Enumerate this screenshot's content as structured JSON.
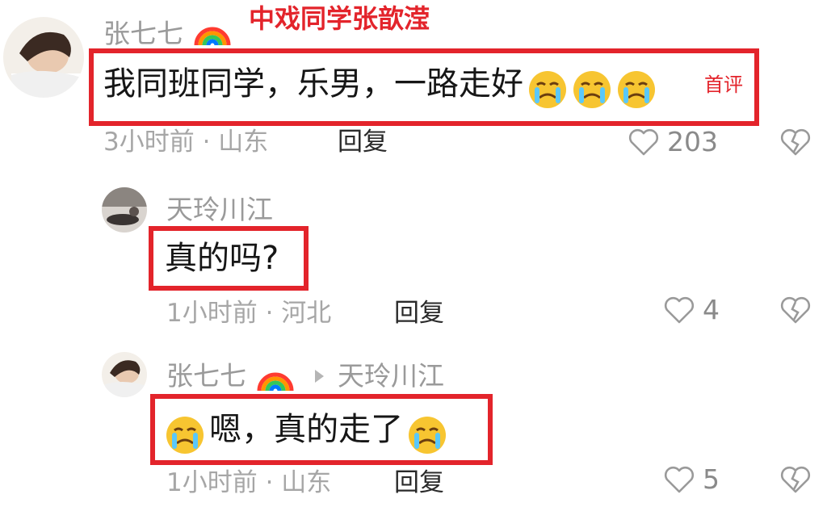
{
  "annotation": "中戏同学张歆滢",
  "comments": [
    {
      "user": "张七七",
      "text": "我同班同学，乐男，一路走好",
      "badge": "首评",
      "meta": "3小时前 · 山东",
      "reply_label": "回复",
      "likes": "203"
    },
    {
      "user": "天玲川江",
      "text": "真的吗?",
      "meta": "1小时前 · 河北",
      "reply_label": "回复",
      "likes": "4"
    },
    {
      "user": "张七七",
      "reply_to": "天玲川江",
      "text_main": "嗯，真的走了",
      "meta": "1小时前 · 山东",
      "reply_label": "回复",
      "likes": "5"
    }
  ],
  "colors": {
    "highlight": "#e3242b",
    "muted": "#a6a6a6"
  },
  "icons": [
    "rainbow-icon",
    "crying-emoji-icon",
    "heart-icon",
    "broken-heart-icon",
    "reply-arrow-icon"
  ]
}
